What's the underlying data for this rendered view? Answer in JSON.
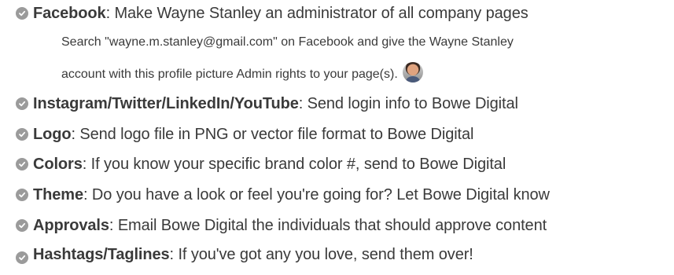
{
  "items": [
    {
      "title": "Facebook",
      "text": ": Make Wayne Stanley an administrator of all company pages",
      "sub": [
        "Search \"wayne.m.stanley@gmail.com\" on Facebook and give the Wayne Stanley",
        "account with this profile picture Admin rights to your page(s)."
      ]
    },
    {
      "title": "Instagram/Twitter/LinkedIn/YouTube",
      "text": ": Send login info to Bowe Digital"
    },
    {
      "title": "Logo",
      "text": ": Send logo file in PNG or vector file format to Bowe Digital"
    },
    {
      "title": "Colors",
      "text": ": If you know your specific brand color #, send to Bowe Digital"
    },
    {
      "title": "Theme",
      "text": ": Do you have a look or feel you're going for? Let Bowe Digital know"
    },
    {
      "title": "Approvals",
      "text": ": Email Bowe Digital the individuals that should approve content"
    },
    {
      "title": "Hashtags/Taglines",
      "text": ": If you've got any you love, send them over!"
    }
  ],
  "colors": {
    "check": "#9b9b9b",
    "text": "#3a3a3a"
  },
  "icons": {
    "check": "check-circle-icon",
    "avatar": "profile-picture"
  }
}
